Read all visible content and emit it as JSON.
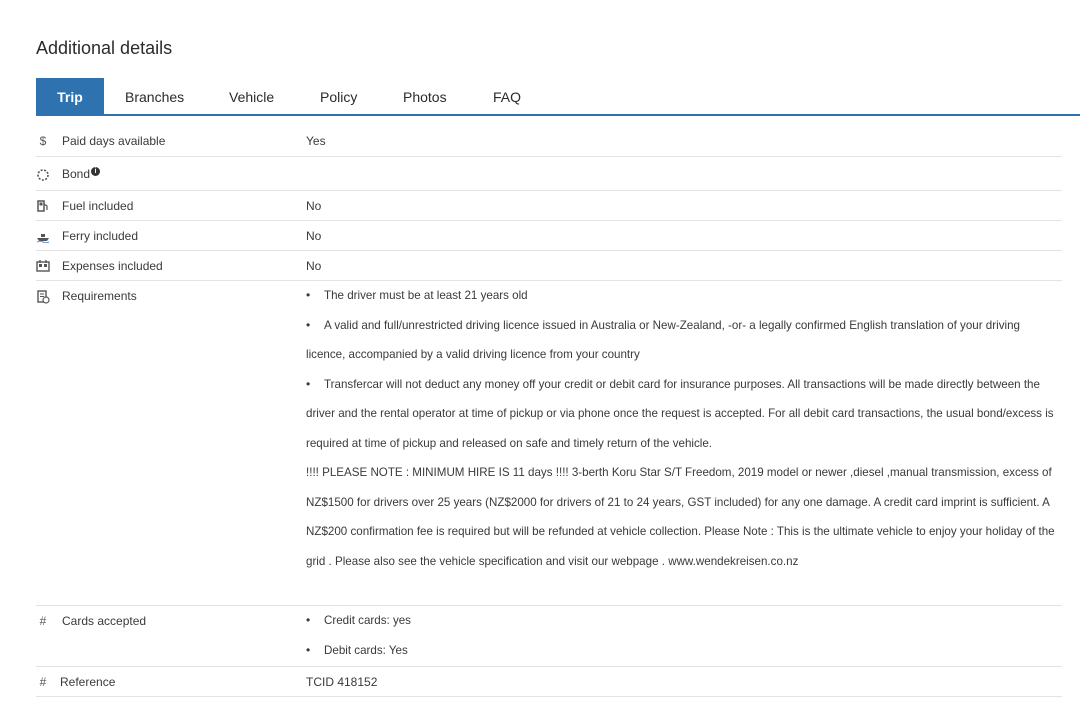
{
  "section_title": "Additional details",
  "tabs": [
    "Trip",
    "Branches",
    "Vehicle",
    "Policy",
    "Photos",
    "FAQ"
  ],
  "rows": {
    "paid_days": {
      "icon": "dollar-icon",
      "label": "Paid days available",
      "value": "Yes"
    },
    "bond": {
      "icon": "gear-icon",
      "label": "Bond",
      "info_icon": "info-icon"
    },
    "fuel": {
      "icon": "fuel-pump-icon",
      "label": "Fuel included",
      "value": "No"
    },
    "ferry": {
      "icon": "ferry-icon",
      "label": "Ferry included",
      "value": "No"
    },
    "expenses": {
      "icon": "expenses-icon",
      "label": "Expenses included",
      "value": "No"
    },
    "requirements": {
      "icon": "requirements-icon",
      "label": "Requirements",
      "items": [
        "The driver must be at least 21 years old",
        "A valid and full/unrestricted driving licence issued in Australia or New-Zealand, -or- a legally confirmed English translation of your driving licence, accompanied by a valid driving licence from your country",
        "Transfercar will not deduct any money off your credit or debit card for insurance purposes. All transactions will be made directly between the driver and the rental operator at time of pickup or via phone once the request is accepted. For all debit card transactions, the usual bond/excess is required at time of pickup and released on safe and timely return of the vehicle."
      ],
      "note": "!!!! PLEASE NOTE : MINIMUM HIRE IS 11 days !!!! 3-berth Koru Star S/T Freedom, 2019 model or newer ,diesel ,manual transmission, excess of NZ$1500 for drivers over 25 years (NZ$2000 for drivers of 21 to 24 years, GST included) for any one damage. A credit card imprint is sufficient. A NZ$200 confirmation fee is required but will be refunded at vehicle collection. Please Note : This is the ultimate vehicle to enjoy your holiday of the grid . Please also see the vehicle specification and visit our webpage . www.wendekreisen.co.nz"
    },
    "cards": {
      "icon": "hash-icon",
      "label": "Cards accepted",
      "items": [
        "Credit cards: yes",
        "Debit cards: Yes"
      ]
    },
    "reference": {
      "icon": "hash-icon",
      "label": "Reference",
      "value": "TCID 418152"
    }
  },
  "icon_glyphs": {
    "dollar": "$",
    "hash": "#",
    "info": "i"
  },
  "colors": {
    "accent": "#2e72b0",
    "text": "#3a3a3a",
    "divider": "#e3e3e3"
  }
}
